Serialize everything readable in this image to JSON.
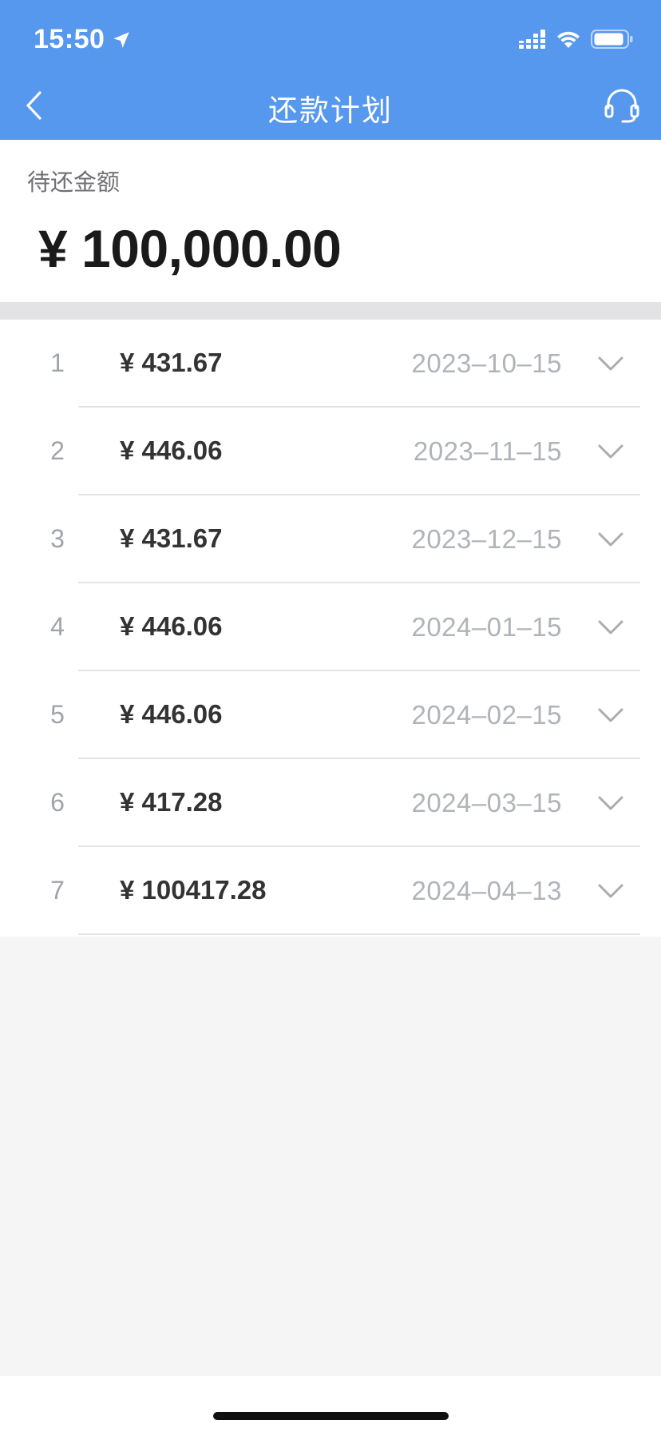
{
  "status_bar": {
    "time": "15:50",
    "icons": [
      "location-arrow-icon",
      "cellular-signal-icon",
      "wifi-icon",
      "battery-icon"
    ]
  },
  "nav": {
    "title": "还款计划",
    "back_icon": "chevron-left-icon",
    "support_icon": "headset-icon"
  },
  "summary": {
    "label": "待还金额",
    "amount": "¥ 100,000.00"
  },
  "plan": {
    "items": [
      {
        "index": "1",
        "amount": "¥ 431.67",
        "date": "2023–10–15"
      },
      {
        "index": "2",
        "amount": "¥ 446.06",
        "date": "2023–11–15"
      },
      {
        "index": "3",
        "amount": "¥ 431.67",
        "date": "2023–12–15"
      },
      {
        "index": "4",
        "amount": "¥ 446.06",
        "date": "2024–01–15"
      },
      {
        "index": "5",
        "amount": "¥ 446.06",
        "date": "2024–02–15"
      },
      {
        "index": "6",
        "amount": "¥ 417.28",
        "date": "2024–03–15"
      },
      {
        "index": "7",
        "amount": "¥ 100417.28",
        "date": "2024–04–13"
      }
    ]
  },
  "colors": {
    "header_bg": "#5698ee",
    "page_bg": "#f5f5f6",
    "text_primary": "#1a1a1a",
    "text_muted": "#b0b3b9"
  }
}
